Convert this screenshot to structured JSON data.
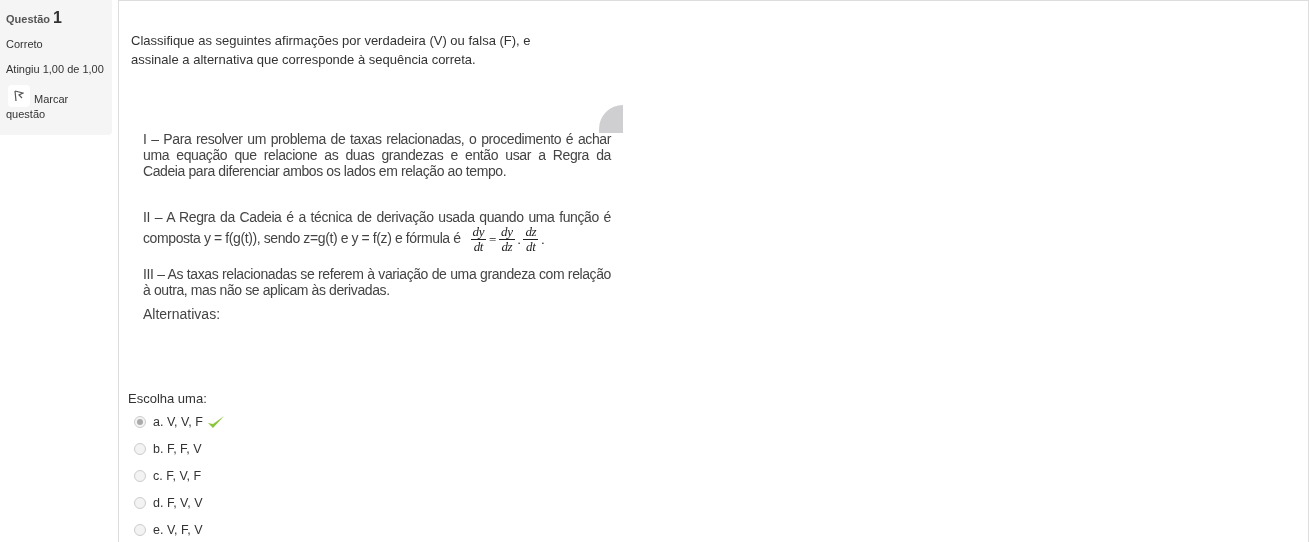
{
  "info": {
    "label": "Questão",
    "number": "1",
    "status": "Correto",
    "grade": "Atingiu 1,00 de 1,00",
    "flag": "Marcar questão"
  },
  "question": {
    "prompt": "Classifique as seguintes afirmações por verdadeira (V) ou falsa (F), e assinale a alternativa que corresponde à sequência correta.",
    "statements": [
      {
        "text": "I – Para resolver um problema de taxas relacionadas, o procedimento é achar uma equação que relacione as duas grandezas e então usar a Regra da Cadeia para diferenciar ambos os lados em relação ao tempo."
      },
      {
        "text": "II – A Regra da Cadeia é a técnica de derivação usada quando uma função é composta y = f(g(t)), sendo z=g(t) e y = f(z) e fórmula é",
        "formula": [
          {
            "kind": "fraction",
            "num": "dy",
            "den": "dt"
          },
          {
            "kind": "symbol",
            "text": "="
          },
          {
            "kind": "fraction",
            "num": "dy",
            "den": "dz"
          },
          {
            "kind": "symbol",
            "text": "."
          },
          {
            "kind": "fraction",
            "num": "dz",
            "den": "dt"
          },
          {
            "kind": "symbol",
            "text": "."
          }
        ]
      },
      {
        "text": "III – As taxas relacionadas se referem à variação de uma grandeza com relação à outra, mas não se aplicam às derivadas."
      }
    ],
    "alternatives_label": "Alternativas:"
  },
  "answer": {
    "label": "Escolha uma:",
    "options": [
      {
        "text": "a. V, V, F",
        "selected": true,
        "correct": true
      },
      {
        "text": "b. F, F, V",
        "selected": false,
        "correct": false
      },
      {
        "text": "c. F, V, F",
        "selected": false,
        "correct": false
      },
      {
        "text": "d. F, V, V",
        "selected": false,
        "correct": false
      },
      {
        "text": "e. V, F, V",
        "selected": false,
        "correct": false
      }
    ]
  }
}
